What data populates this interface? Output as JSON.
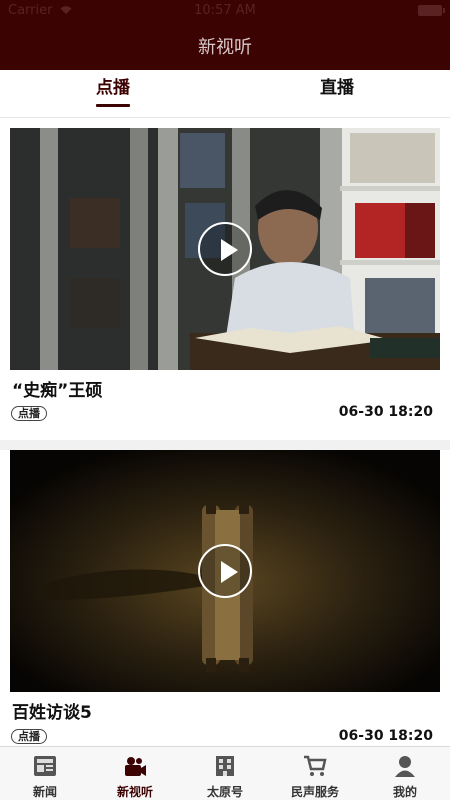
{
  "status_bar": {
    "carrier": "Carrier",
    "time": "10:57 AM"
  },
  "header": {
    "title": "新视听",
    "background": "#3c0303"
  },
  "tabs": {
    "items": [
      {
        "label": "点播",
        "active": true
      },
      {
        "label": "直播",
        "active": false
      }
    ]
  },
  "feed": {
    "items": [
      {
        "title": "“史痴”王硕",
        "badge": "点播",
        "time": "06-30 18:20",
        "thumbnail": "man-reading-in-library"
      },
      {
        "title": "百姓访谈5",
        "badge": "点播",
        "time": "06-30 18:20",
        "thumbnail": "ancient-scroll-on-map"
      }
    ]
  },
  "tabbar": {
    "items": [
      {
        "label": "新闻",
        "icon": "news-icon",
        "active": false
      },
      {
        "label": "新视听",
        "icon": "video-camera-icon",
        "active": true
      },
      {
        "label": "太原号",
        "icon": "building-icon",
        "active": false
      },
      {
        "label": "民声服务",
        "icon": "cart-icon",
        "active": false
      },
      {
        "label": "我的",
        "icon": "user-icon",
        "active": false
      }
    ]
  },
  "colors": {
    "accent": "#3c0303",
    "tab_inactive": "#333333"
  }
}
